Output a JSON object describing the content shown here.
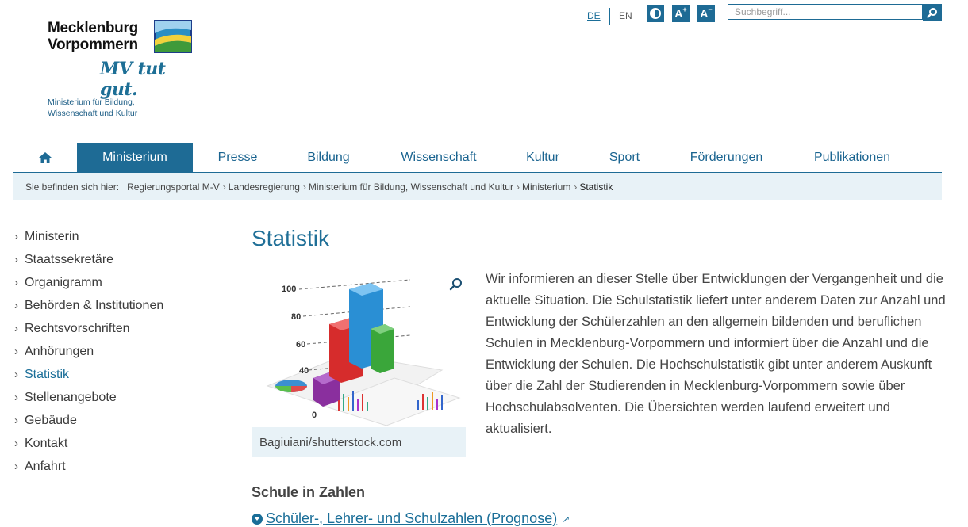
{
  "logo": {
    "line1": "Mecklenburg",
    "line2": "Vorpommern",
    "slogan": "MV tut gut.",
    "ministry_line1": "Ministerium für Bildung,",
    "ministry_line2": "Wissenschaft und Kultur"
  },
  "header": {
    "lang_de": "DE",
    "lang_en": "EN",
    "font_increase": "A",
    "font_decrease": "A",
    "search_placeholder": "Suchbegriff..."
  },
  "nav": {
    "items": [
      {
        "label": "Ministerium",
        "active": true
      },
      {
        "label": "Presse"
      },
      {
        "label": "Bildung"
      },
      {
        "label": "Wissenschaft"
      },
      {
        "label": "Kultur"
      },
      {
        "label": "Sport"
      },
      {
        "label": "Förderungen"
      },
      {
        "label": "Publikationen"
      }
    ]
  },
  "breadcrumb": {
    "label": "Sie befinden sich hier:",
    "items": [
      "Regierungsportal M-V",
      "Landesregierung",
      "Ministerium für Bildung, Wissenschaft und Kultur",
      "Ministerium",
      "Statistik"
    ]
  },
  "sidebar": {
    "items": [
      "Ministerin",
      "Staatssekretäre",
      "Organigramm",
      "Behörden & Institutionen",
      "Rechtsvorschriften",
      "Anhörungen",
      "Statistik",
      "Stellenangebote",
      "Gebäude",
      "Kontakt",
      "Anfahrt"
    ],
    "active": "Statistik"
  },
  "main": {
    "title": "Statistik",
    "image_caption": "Bagiuiani/shutterstock.com",
    "intro": "Wir informieren an dieser Stelle über Entwicklungen der Vergangenheit und die aktuelle Situation. Die Schulstatistik liefert unter anderem Daten zur Anzahl und Entwicklung der Schülerzahlen an den allgemein bildenden und beruflichen Schulen in Mecklenburg-Vorpommern und informiert über die Anzahl und die Entwicklung der Schulen. Die Hochschulstatistik gibt unter anderem Auskunft über die Zahl der Studierenden in Mecklenburg-Vorpommern sowie über Hochschulabsolventen. Die Übersichten werden laufend erweitert und aktualisiert.",
    "section_heading": "Schule in Zahlen",
    "link_label": "Schüler-, Lehrer- und Schulzahlen (Prognose)",
    "image_axis_labels": [
      "100",
      "80",
      "60",
      "40",
      "0"
    ]
  },
  "colors": {
    "brand": "#1e6b95",
    "link": "#1a6e98",
    "breadcrumb_bg": "#e8f2f7"
  }
}
